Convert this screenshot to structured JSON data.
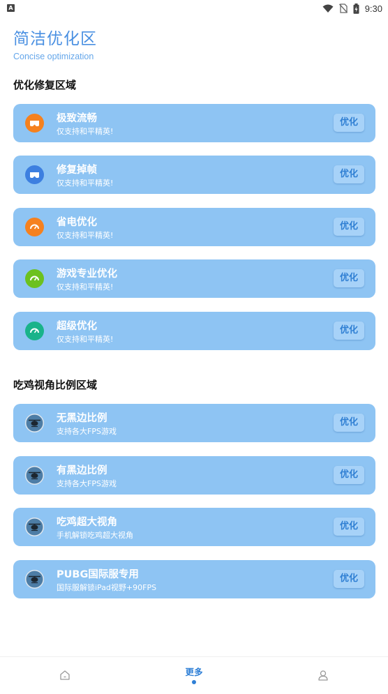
{
  "status_bar": {
    "app_icon_letter": "A",
    "time": "9:30",
    "icons": [
      "wifi-icon",
      "no-sim-icon",
      "battery-icon"
    ]
  },
  "header": {
    "title": "简洁优化区",
    "subtitle": "Concise optimization"
  },
  "sections": [
    {
      "title": "优化修复区域",
      "items": [
        {
          "title": "极致流畅",
          "subtitle": "仅支持和平精英!",
          "button": "优化",
          "icon": "vr-headset-icon",
          "icon_color": "#f5811f"
        },
        {
          "title": "修复掉帧",
          "subtitle": "仅支持和平精英!",
          "button": "优化",
          "icon": "vr-headset-icon",
          "icon_color": "#3d7fe0"
        },
        {
          "title": "省电优化",
          "subtitle": "仅支持和平精英!",
          "button": "优化",
          "icon": "speedometer-icon",
          "icon_color": "#f5811f"
        },
        {
          "title": "游戏专业优化",
          "subtitle": "仅支持和平精英!",
          "button": "优化",
          "icon": "speedometer-icon",
          "icon_color": "#6cc11f"
        },
        {
          "title": "超级优化",
          "subtitle": "仅支持和平精英!",
          "button": "优化",
          "icon": "speedometer-icon",
          "icon_color": "#19b38a"
        }
      ]
    },
    {
      "title": "吃鸡视角比例区域",
      "items": [
        {
          "title": "无黑边比例",
          "subtitle": "支持各大FPS游戏",
          "button": "优化",
          "icon": "helicopter-icon",
          "icon_color": "#dfe7ee"
        },
        {
          "title": "有黑边比例",
          "subtitle": "支持各大FPS游戏",
          "button": "优化",
          "icon": "helicopter-icon",
          "icon_color": "#dfe7ee"
        },
        {
          "title": "吃鸡超大视角",
          "subtitle": "手机解锁吃鸡超大视角",
          "button": "优化",
          "icon": "helicopter-icon",
          "icon_color": "#dfe7ee"
        },
        {
          "title": "PUBG国际服专用",
          "subtitle": "国际服解锁iPad视野+90FPS",
          "button": "优化",
          "icon": "helicopter-icon",
          "icon_color": "#dfe7ee"
        }
      ]
    }
  ],
  "bottom_nav": {
    "items": [
      {
        "label": "",
        "icon": "home-icon",
        "active": false
      },
      {
        "label": "更多",
        "icon": "",
        "active": true
      },
      {
        "label": "",
        "icon": "user-icon",
        "active": false
      }
    ]
  },
  "colors": {
    "accent": "#4a90e2",
    "card": "#8ec4f3",
    "button_bg": "#a7d2f8",
    "button_text": "#2f7fd3"
  }
}
